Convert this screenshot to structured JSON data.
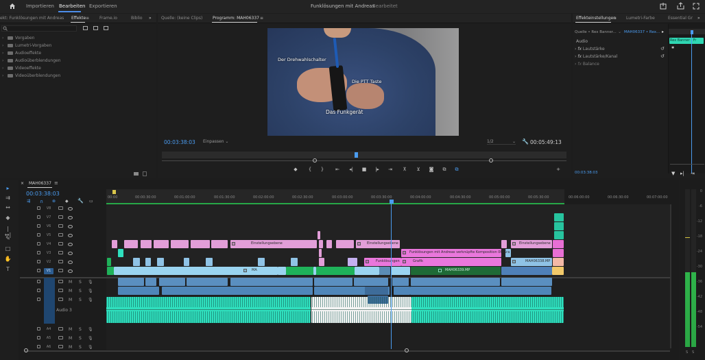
{
  "header": {
    "nav": [
      "Importieren",
      "Bearbeiten",
      "Exportieren"
    ],
    "active": "Bearbeiten",
    "project_title": "Funklösungen mit Andreas",
    "project_status": "Bearbeitet"
  },
  "project_panel": {
    "tabs": [
      "ekt: Funklösungen mit Andreas",
      "Effekte",
      "Frame.io",
      "Biblio"
    ],
    "active_tab": "Effekte",
    "folders": [
      "Vorgaben",
      "Lumetri-Vorgaben",
      "Audioeffekte",
      "Audioüberblendungen",
      "Videoeffekte",
      "Videoüberblendungen"
    ]
  },
  "source_tab": "Quelle: (keine Clips)",
  "program": {
    "tab": "Programm: MAH06337",
    "timecode": "00:03:38:03",
    "fit_label": "Einpassen",
    "resolution": "1/2",
    "duration": "00:05:49:13",
    "overlay_labels": [
      "Der Drehwahlschalter",
      "Die PTT Taste",
      "Das Funkgerät"
    ]
  },
  "effect_controls": {
    "tabs": [
      "Effekteinstellungen",
      "Lumetri-Farbe",
      "Essential Gr"
    ],
    "source": "Quelle • Rex Banner...",
    "clip": "MAH06337 • Rex...",
    "section": "Audio",
    "rows": [
      "Lautstärke",
      "Lautstärke/Kanal",
      "Balance"
    ],
    "mini_clip": "Rex Banner - Fr",
    "timecode": "00:03:38:03"
  },
  "timeline": {
    "sequence": "MAH06337",
    "timecode": "00:03:38:03",
    "ruler": [
      "00:00",
      "00:00:30:00",
      "00:01:00:00",
      "00:01:30:00",
      "00:02:00:00",
      "00:02:30:00",
      "00:03:00:00",
      "00:03:30:00",
      "00:04:00:00",
      "00:04:30:00",
      "00:05:00:00",
      "00:05:30:00",
      "00:06:00:00",
      "00:06:30:00",
      "00:07:00:00"
    ],
    "video_tracks": [
      "V8",
      "V7",
      "V6",
      "V5",
      "V4",
      "V3",
      "V2",
      "V1"
    ],
    "audio_tracks": [
      "A1",
      "A2",
      "A3",
      "A4",
      "A5",
      "A6"
    ],
    "audio3_name": "Audio 3",
    "clip_labels": {
      "adjust1": "Einstellungsebene",
      "adjust2": "Einstellungsebene",
      "adjust3": "Einstellungsebene",
      "nested": "Funklösungen mit Andreas verknüpfte Komposition 06/Gra",
      "funk": "Funklösungen",
      "grafik": "Grafik",
      "mah_v2": "MAH06338.MP",
      "mah_v1": "MAH06339.MP",
      "ma": "MA"
    },
    "track_buttons": {
      "mute": "M",
      "solo": "S"
    }
  },
  "meters": {
    "scale": [
      "0",
      "-6",
      "-12",
      "-18",
      "-24",
      "-30",
      "-36",
      "-42",
      "-48",
      "-54"
    ],
    "footer": [
      "S",
      "S"
    ]
  },
  "colors": {
    "accent": "#4b9cf0",
    "pink": "#e29ed8",
    "magenta": "#ea77dc",
    "teal": "#3be6c3",
    "lightblue": "#9ad4f0",
    "green": "#22b45c",
    "playhead": "#4b9cf0"
  }
}
